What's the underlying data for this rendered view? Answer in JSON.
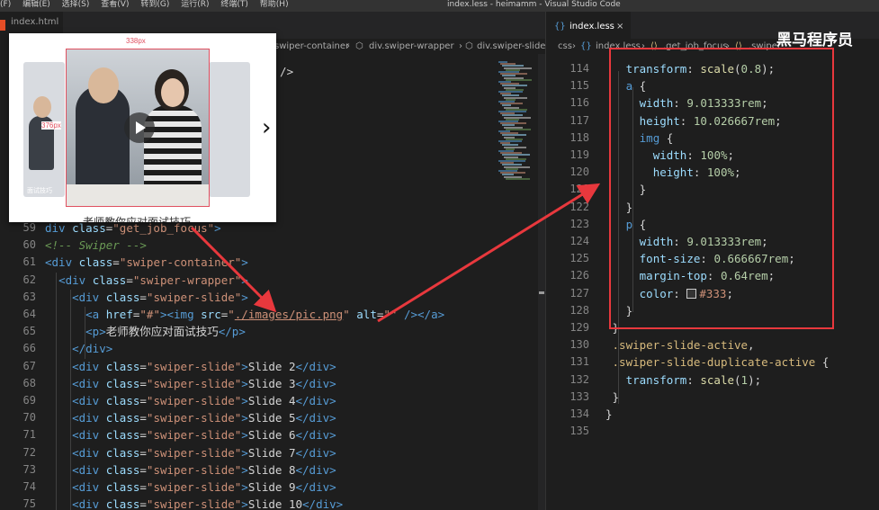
{
  "titlebar": {
    "menu": [
      "(F)",
      "编辑(E)",
      "选择(S)",
      "查看(V)",
      "转到(G)",
      "运行(R)",
      "终端(T)",
      "帮助(H)"
    ],
    "window_title": "index.less - heimamm - Visual Studio Code"
  },
  "left_editor": {
    "tab_label": "index.html",
    "breadcrumb": [
      "swiper-container",
      "div.swiper-wrapper",
      "div.swiper-slide"
    ],
    "preview": {
      "width_label": "338px",
      "height_label": "376px",
      "caption": "老师教你应对面试技巧",
      "side_label": "面试技巧"
    },
    "snippet_fragment": "\" />",
    "lines": [
      {
        "n": "59",
        "html": "<span class='tag'>div</span> <span class='attr'>class</span>=<span class='str'>\"get_job_focus\"</span><span class='tag'>&gt;</span>"
      },
      {
        "n": "60",
        "html": "<span class='cmt'>&lt;!-- Swiper --&gt;</span>"
      },
      {
        "n": "61",
        "html": "<span class='tag'>&lt;div</span> <span class='attr'>class</span>=<span class='str'>\"swiper-container\"</span><span class='tag'>&gt;</span>"
      },
      {
        "n": "62",
        "html": "  <span class='tag'>&lt;div</span> <span class='attr'>class</span>=<span class='str'>\"swiper-wrapper\"</span><span class='tag'>&gt;</span>"
      },
      {
        "n": "63",
        "html": "    <span class='tag'>&lt;div</span> <span class='attr'>class</span>=<span class='str'>\"swiper-slide\"</span><span class='tag'>&gt;</span>"
      },
      {
        "n": "64",
        "html": "      <span class='tag'>&lt;a</span> <span class='attr'>href</span>=<span class='str'>\"#\"</span><span class='tag'>&gt;&lt;img</span> <span class='attr'>src</span>=<span class='str'>\"<u>./images/pic.png</u>\"</span> <span class='attr'>alt</span>=<span class='str'>\"\"</span> <span class='tag'>/&gt;&lt;/a&gt;</span>"
      },
      {
        "n": "65",
        "html": "      <span class='tag'>&lt;p&gt;</span>老师教你应对面试技巧<span class='tag'>&lt;/p&gt;</span>"
      },
      {
        "n": "66",
        "html": "    <span class='tag'>&lt;/div&gt;</span>"
      },
      {
        "n": "67",
        "html": "    <span class='tag'>&lt;div</span> <span class='attr'>class</span>=<span class='str'>\"swiper-slide\"</span><span class='tag'>&gt;</span>Slide 2<span class='tag'>&lt;/div&gt;</span>"
      },
      {
        "n": "68",
        "html": "    <span class='tag'>&lt;div</span> <span class='attr'>class</span>=<span class='str'>\"swiper-slide\"</span><span class='tag'>&gt;</span>Slide 3<span class='tag'>&lt;/div&gt;</span>"
      },
      {
        "n": "69",
        "html": "    <span class='tag'>&lt;div</span> <span class='attr'>class</span>=<span class='str'>\"swiper-slide\"</span><span class='tag'>&gt;</span>Slide 4<span class='tag'>&lt;/div&gt;</span>"
      },
      {
        "n": "70",
        "html": "    <span class='tag'>&lt;div</span> <span class='attr'>class</span>=<span class='str'>\"swiper-slide\"</span><span class='tag'>&gt;</span>Slide 5<span class='tag'>&lt;/div&gt;</span>"
      },
      {
        "n": "71",
        "html": "    <span class='tag'>&lt;div</span> <span class='attr'>class</span>=<span class='str'>\"swiper-slide\"</span><span class='tag'>&gt;</span>Slide 6<span class='tag'>&lt;/div&gt;</span>"
      },
      {
        "n": "72",
        "html": "    <span class='tag'>&lt;div</span> <span class='attr'>class</span>=<span class='str'>\"swiper-slide\"</span><span class='tag'>&gt;</span>Slide 7<span class='tag'>&lt;/div&gt;</span>"
      },
      {
        "n": "73",
        "html": "    <span class='tag'>&lt;div</span> <span class='attr'>class</span>=<span class='str'>\"swiper-slide\"</span><span class='tag'>&gt;</span>Slide 8<span class='tag'>&lt;/div&gt;</span>"
      },
      {
        "n": "74",
        "html": "    <span class='tag'>&lt;div</span> <span class='attr'>class</span>=<span class='str'>\"swiper-slide\"</span><span class='tag'>&gt;</span>Slide 9<span class='tag'>&lt;/div&gt;</span>"
      },
      {
        "n": "75",
        "html": "    <span class='tag'>&lt;div</span> <span class='attr'>class</span>=<span class='str'>\"swiper-slide\"</span><span class='tag'>&gt;</span>Slide 10<span class='tag'>&lt;/div&gt;</span>"
      }
    ]
  },
  "right_editor": {
    "tab_label": "index.less",
    "breadcrumb": [
      "css",
      "index.less",
      ".get_job_focus",
      ".swiper"
    ],
    "brand": "黑马程序员",
    "lines": [
      {
        "n": "114",
        "html": "   <span class='prop'>transform</span>: <span class='fn'>scale</span>(<span class='num'>0.8</span>);"
      },
      {
        "n": "115",
        "html": "   <span class='tag'>a</span> {"
      },
      {
        "n": "116",
        "html": "     <span class='prop'>width</span>: <span class='num'>9.013333rem</span>;"
      },
      {
        "n": "117",
        "html": "     <span class='prop'>height</span>: <span class='num'>10.026667rem</span>;"
      },
      {
        "n": "118",
        "html": "     <span class='tag'>img</span> {"
      },
      {
        "n": "119",
        "html": "       <span class='prop'>width</span>: <span class='num'>100%</span>;"
      },
      {
        "n": "120",
        "html": "       <span class='prop'>height</span>: <span class='num'>100%</span>;"
      },
      {
        "n": "121",
        "html": "     }"
      },
      {
        "n": "122",
        "html": "   }"
      },
      {
        "n": "123",
        "html": "   <span class='tag'>p</span> {"
      },
      {
        "n": "124",
        "html": "     <span class='prop'>width</span>: <span class='num'>9.013333rem</span>;"
      },
      {
        "n": "125",
        "html": "     <span class='prop'>font-size</span>: <span class='num'>0.666667rem</span>;"
      },
      {
        "n": "126",
        "html": "     <span class='prop'>margin-top</span>: <span class='num'>0.64rem</span>;"
      },
      {
        "n": "127",
        "html": "     <span class='prop'>color</span>: <span class='sq'></span><span class='str'>#333</span>;"
      },
      {
        "n": "128",
        "html": "   }"
      },
      {
        "n": "129",
        "html": " }"
      },
      {
        "n": "130",
        "html": " <span class='sel'>.swiper-slide-active</span>,"
      },
      {
        "n": "131",
        "html": " <span class='sel'>.swiper-slide-duplicate-active</span> {"
      },
      {
        "n": "132",
        "html": "   <span class='prop'>transform</span>: <span class='fn'>scale</span>(<span class='num'>1</span>);"
      },
      {
        "n": "133",
        "html": " }"
      },
      {
        "n": "134",
        "html": "}"
      },
      {
        "n": "135",
        "html": ""
      }
    ]
  },
  "colors": {
    "editor_bg": "#1e1e1e",
    "annotation_red": "#e8383d",
    "tag_blue": "#569cd6",
    "string_orange": "#ce9178"
  }
}
